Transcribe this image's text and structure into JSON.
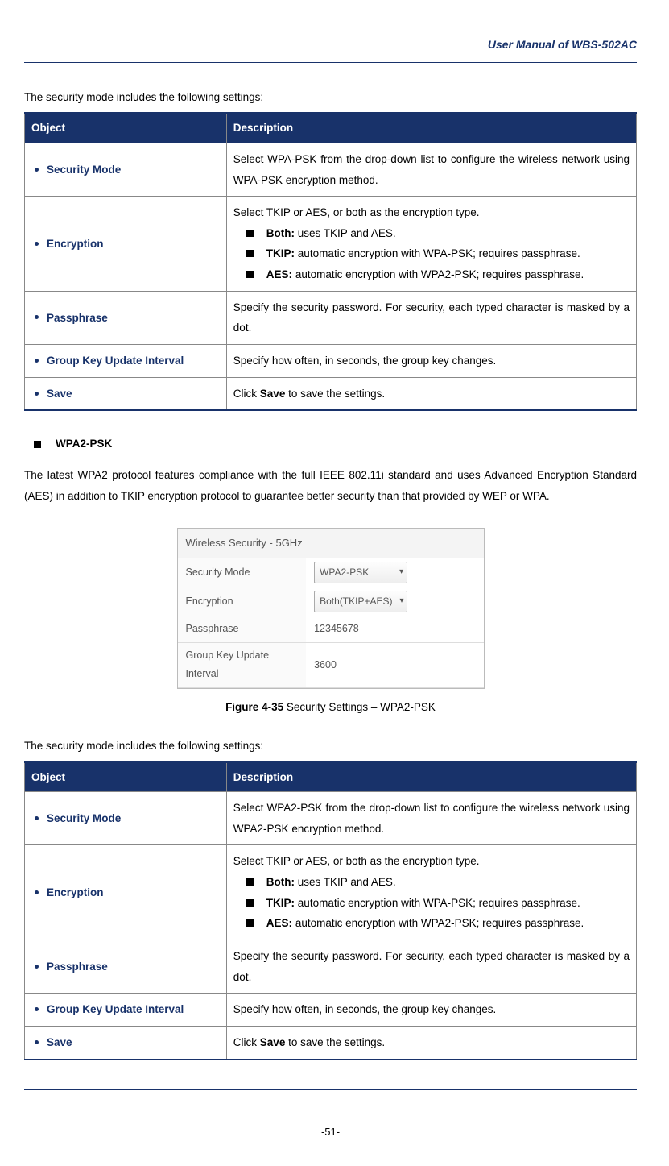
{
  "header": "User Manual of WBS-502AC",
  "intro1": "The security mode includes the following settings:",
  "table_headers": {
    "object": "Object",
    "description": "Description"
  },
  "table1": {
    "rows": [
      {
        "obj": "Security Mode",
        "desc_type": "plain",
        "desc": "Select WPA-PSK from the drop-down list to configure the wireless network using WPA-PSK encryption method."
      },
      {
        "obj": "Encryption",
        "desc_type": "enc",
        "lead": "Select TKIP or AES, or both as the encryption type.",
        "items": [
          {
            "b": "Both:",
            "t": " uses TKIP and AES."
          },
          {
            "b": "TKIP:",
            "t": " automatic encryption with WPA-PSK; requires passphrase."
          },
          {
            "b": "AES:",
            "t": " automatic encryption with WPA2-PSK; requires passphrase."
          }
        ]
      },
      {
        "obj": "Passphrase",
        "desc_type": "plain",
        "desc": "Specify the security password. For security, each typed character is masked by a dot."
      },
      {
        "obj": "Group Key Update Interval",
        "desc_type": "plain",
        "desc": "Specify how often, in seconds, the group key changes."
      },
      {
        "obj": "Save",
        "desc_type": "save",
        "pre": "Click ",
        "b": "Save",
        "post": " to save the settings."
      }
    ]
  },
  "section_heading": "WPA2-PSK",
  "section_body": "The latest WPA2 protocol features compliance with the full IEEE 802.11i standard and uses Advanced Encryption Standard (AES) in addition to TKIP encryption protocol to guarantee better security than that provided by WEP or WPA.",
  "figure": {
    "title": "Wireless Security - 5GHz",
    "fields": [
      {
        "label": "Security Mode",
        "type": "select",
        "value": "WPA2-PSK"
      },
      {
        "label": "Encryption",
        "type": "select",
        "value": "Both(TKIP+AES)"
      },
      {
        "label": "Passphrase",
        "type": "text",
        "value": "12345678"
      },
      {
        "label": "Group Key Update Interval",
        "type": "text",
        "value": "3600"
      }
    ]
  },
  "caption": {
    "b": "Figure 4-35",
    "t": " Security Settings – WPA2-PSK"
  },
  "intro2": "The security mode includes the following settings:",
  "table2": {
    "rows": [
      {
        "obj": "Security Mode",
        "desc_type": "plain",
        "desc": "Select WPA2-PSK from the drop-down list to configure the wireless network using WPA2-PSK encryption method."
      },
      {
        "obj": "Encryption",
        "desc_type": "enc",
        "lead": "Select TKIP or AES, or both as the encryption type.",
        "items": [
          {
            "b": "Both:",
            "t": " uses TKIP and AES."
          },
          {
            "b": "TKIP:",
            "t": " automatic encryption with WPA-PSK; requires passphrase."
          },
          {
            "b": "AES:",
            "t": " automatic encryption with WPA2-PSK; requires passphrase."
          }
        ]
      },
      {
        "obj": "Passphrase",
        "desc_type": "plain",
        "desc": "Specify the security password. For security, each typed character is masked by a dot."
      },
      {
        "obj": "Group Key Update Interval",
        "desc_type": "plain",
        "desc": "Specify how often, in seconds, the group key changes."
      },
      {
        "obj": "Save",
        "desc_type": "save",
        "pre": "Click ",
        "b": "Save",
        "post": " to save the settings."
      }
    ]
  },
  "pagenum": "-51-"
}
